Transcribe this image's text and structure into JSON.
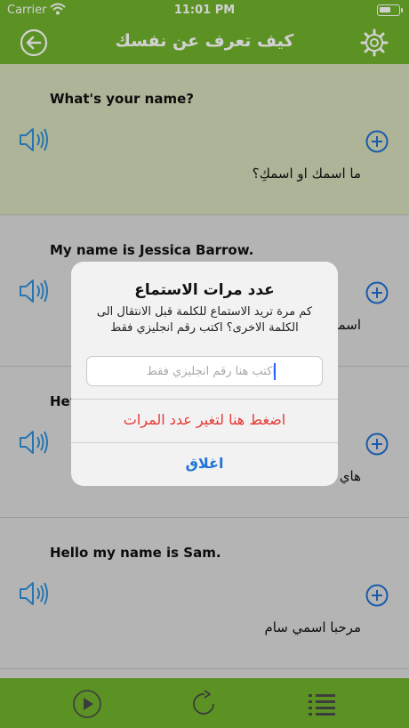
{
  "status_bar": {
    "carrier": "Carrier",
    "time": "11:01 PM"
  },
  "nav": {
    "title": "كيف تعرف عن نفسك"
  },
  "rows": [
    {
      "english": "What's your name?",
      "arabic": "ما اسمك او اسمكِ؟",
      "active": true
    },
    {
      "english": "My name is Jessica Barrow.",
      "arabic": "اسمي جيسيكا بارو"
    },
    {
      "english": "Hey",
      "arabic": "هاي"
    },
    {
      "english": "Hello my name is Sam.",
      "arabic": "مرحبا اسمي سام"
    }
  ],
  "dialog": {
    "title": "عدد مرات الاستماع",
    "message": "كم مرة تريد الاستماع للكلمة قبل الانتقال الى الكلمة الاخرى؟ اكتب رقم انجليزي فقط",
    "input_placeholder": "اكتب هنا رقم انجليزي فقط",
    "change_button": "اضغط هنا لتغير عدد المرات",
    "close_button": "اغلاق"
  },
  "colors": {
    "accent_green": "#6fb22b",
    "active_row": "#d5dcb9",
    "destructive": "#e53935",
    "link_blue": "#1e74d8"
  },
  "icons": {
    "back": "back-arrow-icon",
    "settings": "gear-icon",
    "speaker": "speaker-icon",
    "add": "plus-circle-icon",
    "play": "play-icon",
    "repeat": "repeat-icon",
    "list": "list-icon"
  }
}
